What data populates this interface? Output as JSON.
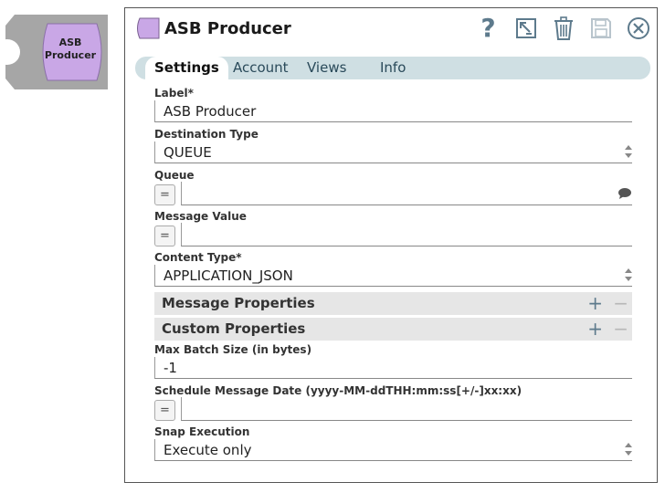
{
  "snap_icon": {
    "label_line1": "ASB",
    "label_line2": "Producer",
    "color": "#c9a7e6"
  },
  "dialog": {
    "title": "ASB Producer",
    "toolbar": {
      "help": "?",
      "export": "export-icon",
      "delete": "trash-icon",
      "save": "save-icon",
      "close": "close-icon"
    }
  },
  "tabs": [
    "Settings",
    "Account",
    "Views",
    "Info"
  ],
  "form": {
    "label": {
      "title": "Label*",
      "value": "ASB Producer"
    },
    "destination_type": {
      "title": "Destination Type",
      "value": "QUEUE"
    },
    "queue": {
      "title": "Queue",
      "value": ""
    },
    "message_value": {
      "title": "Message Value",
      "value": ""
    },
    "content_type": {
      "title": "Content Type*",
      "value": "APPLICATION_JSON"
    },
    "message_properties": {
      "title": "Message Properties",
      "add": "+",
      "remove": "−"
    },
    "custom_properties": {
      "title": "Custom Properties",
      "add": "+",
      "remove": "−"
    },
    "max_batch_size": {
      "title": "Max Batch Size (in bytes)",
      "value": "-1"
    },
    "schedule_date": {
      "title": "Schedule Message Date (yyyy-MM-ddTHH:mm:ss[+/-]xx:xx)",
      "value": ""
    },
    "snap_execution": {
      "title": "Snap Execution",
      "value": "Execute only"
    },
    "expression_toggle": "="
  },
  "colors": {
    "accent": "#5d7a8c",
    "tab_bar": "#cfdfe3",
    "section_bg": "#e6e6e6"
  }
}
